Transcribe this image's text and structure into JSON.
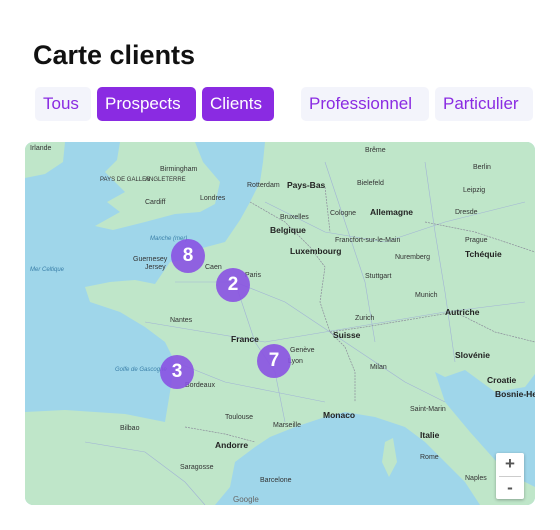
{
  "title": "Carte clients",
  "filters": [
    {
      "label": "Tous",
      "active": false
    },
    {
      "label": "Prospects",
      "active": true
    },
    {
      "label": "Clients",
      "active": true
    },
    {
      "label": "Professionnel",
      "active": false
    },
    {
      "label": "Particulier",
      "active": false
    }
  ],
  "colors": {
    "accent": "#8a2be2",
    "chip_bg": "#f3f4fb",
    "cluster": "#894ee2",
    "sea": "#9fd6ea",
    "land": "#bfe6c9"
  },
  "map": {
    "labels": {
      "irlande": "Irlande",
      "birmingham": "Birmingham",
      "pays_de_galles": "PAYS DE GALLES",
      "angleterre": "ANGLETERRE",
      "cardiff": "Cardiff",
      "londres": "Londres",
      "rotterdam": "Rotterdam",
      "pays_bas": "Pays-Bas",
      "breme": "Brême",
      "berlin": "Berlin",
      "bielefeld": "Bielefeld",
      "allemagne": "Allemagne",
      "bruxelles": "Bruxelles",
      "cologne": "Cologne",
      "belgique": "Belgique",
      "leipzig": "Leipzig",
      "dresde": "Dresde",
      "luxembourg": "Luxembourg",
      "francfort": "Francfort-sur-le-Main",
      "prague": "Prague",
      "tcheque": "Tchéquie",
      "guernesey": "Guernesey",
      "jersey": "Jersey",
      "paris": "Paris",
      "nuremberg": "Nuremberg",
      "stuttgart": "Stuttgart",
      "munich": "Munich",
      "autriche": "Autriche",
      "zurich": "Zurich",
      "nantes": "Nantes",
      "france": "France",
      "suisse": "Suisse",
      "geneve": "Genève",
      "lyon": "Lyon",
      "milan": "Milan",
      "slovenie": "Slovénie",
      "croatie": "Croatie",
      "bordeaux": "Bordeaux",
      "toulouse": "Toulouse",
      "marseille": "Marseille",
      "monaco": "Monaco",
      "andorre": "Andorre",
      "italie": "Italie",
      "bosnie": "Bosnie-Herz",
      "saint_marin": "Saint-Marin",
      "rome": "Rome",
      "naples": "Naples",
      "saragosse": "Saragosse",
      "barcelone": "Barcelone",
      "bilbao": "Bilbao",
      "manche": "Manche (mer)",
      "golfe": "Golfe de Gascogne",
      "mer_celtique": "Mer Celtique"
    },
    "clusters": [
      {
        "count": "8",
        "near": "Caen"
      },
      {
        "count": "2",
        "near": "Paris"
      },
      {
        "count": "3",
        "near": "Bordeaux"
      },
      {
        "count": "7",
        "near": "Lyon"
      }
    ],
    "zoom_in": "+",
    "zoom_out": "-",
    "attribution": "Google"
  }
}
